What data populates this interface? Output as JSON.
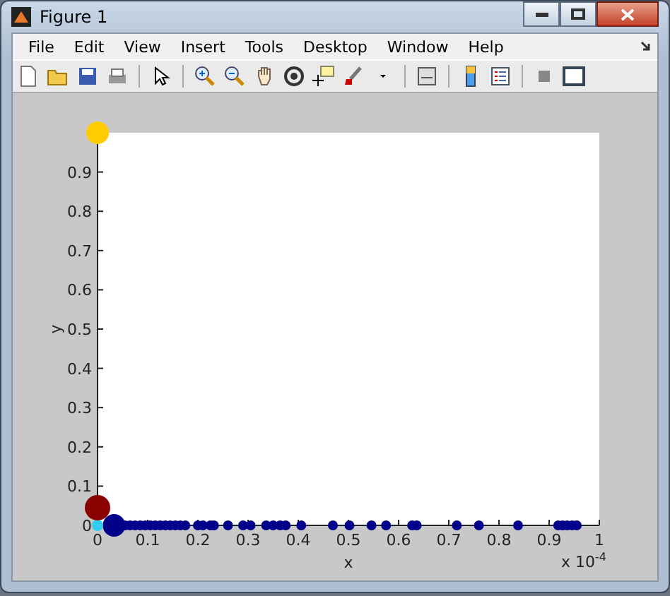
{
  "window": {
    "title": "Figure 1"
  },
  "menu": [
    "File",
    "Edit",
    "View",
    "Insert",
    "Tools",
    "Desktop",
    "Window",
    "Help"
  ],
  "plot": {
    "exponent_label": "x 10$^{-4}$",
    "chart_data": {
      "type": "scatter",
      "xlabel": "x",
      "ylabel": "y",
      "xlim": [
        0,
        1
      ],
      "ylim": [
        0,
        1
      ],
      "xticks": [
        0,
        0.1,
        0.2,
        0.3,
        0.4,
        0.5,
        0.6,
        0.7,
        0.8,
        0.9,
        1
      ],
      "yticks": [
        0,
        0.1,
        0.2,
        0.3,
        0.4,
        0.5,
        0.6,
        0.7,
        0.8,
        0.9
      ],
      "series": [
        {
          "color": "#00008b",
          "x": [
            0.033
          ],
          "values": [
            0
          ]
        },
        {
          "color": "#00008b",
          "x": [
            0.055,
            0.065,
            0.075,
            0.085,
            0.095,
            0.105,
            0.115,
            0.125,
            0.135,
            0.145,
            0.155,
            0.165,
            0.175,
            0.2,
            0.21,
            0.225,
            0.232,
            0.26,
            0.29,
            0.305,
            0.336,
            0.35,
            0.364,
            0.375,
            0.406,
            0.469,
            0.502,
            0.546,
            0.575,
            0.627,
            0.636,
            0.716,
            0.76,
            0.838,
            0.918,
            0.927,
            0.936,
            0.946,
            0.955
          ],
          "values": [
            0,
            0,
            0,
            0,
            0,
            0,
            0,
            0,
            0,
            0,
            0,
            0,
            0,
            0,
            0,
            0,
            0,
            0,
            0,
            0,
            0,
            0,
            0,
            0,
            0,
            0,
            0,
            0,
            0,
            0,
            0,
            0,
            0,
            0,
            0,
            0,
            0,
            0,
            0
          ]
        },
        {
          "color": "#33ccee",
          "x": [
            0
          ],
          "values": [
            0
          ]
        },
        {
          "color": "#8b0000",
          "x": [
            0
          ],
          "values": [
            0.045
          ]
        },
        {
          "color": "#ffcc00",
          "x": [
            0
          ],
          "values": [
            1
          ]
        }
      ]
    }
  }
}
